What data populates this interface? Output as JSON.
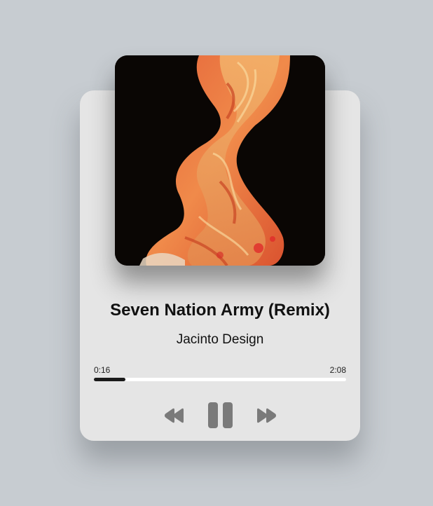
{
  "player": {
    "title": "Seven Nation Army (Remix)",
    "artist": "Jacinto Design",
    "current_time": "0:16",
    "duration": "2:08",
    "progress": 0.125,
    "state": "playing"
  },
  "controls": {
    "rewind_icon": "rewind-icon",
    "pause_icon": "pause-icon",
    "fast_forward_icon": "fast-forward-icon"
  },
  "colors": {
    "background": "#c7ccd1",
    "card": "#e5e5e5",
    "control": "#7a7a7a",
    "progress_fill": "#1a1a1a",
    "progress_track": "#ffffff"
  }
}
